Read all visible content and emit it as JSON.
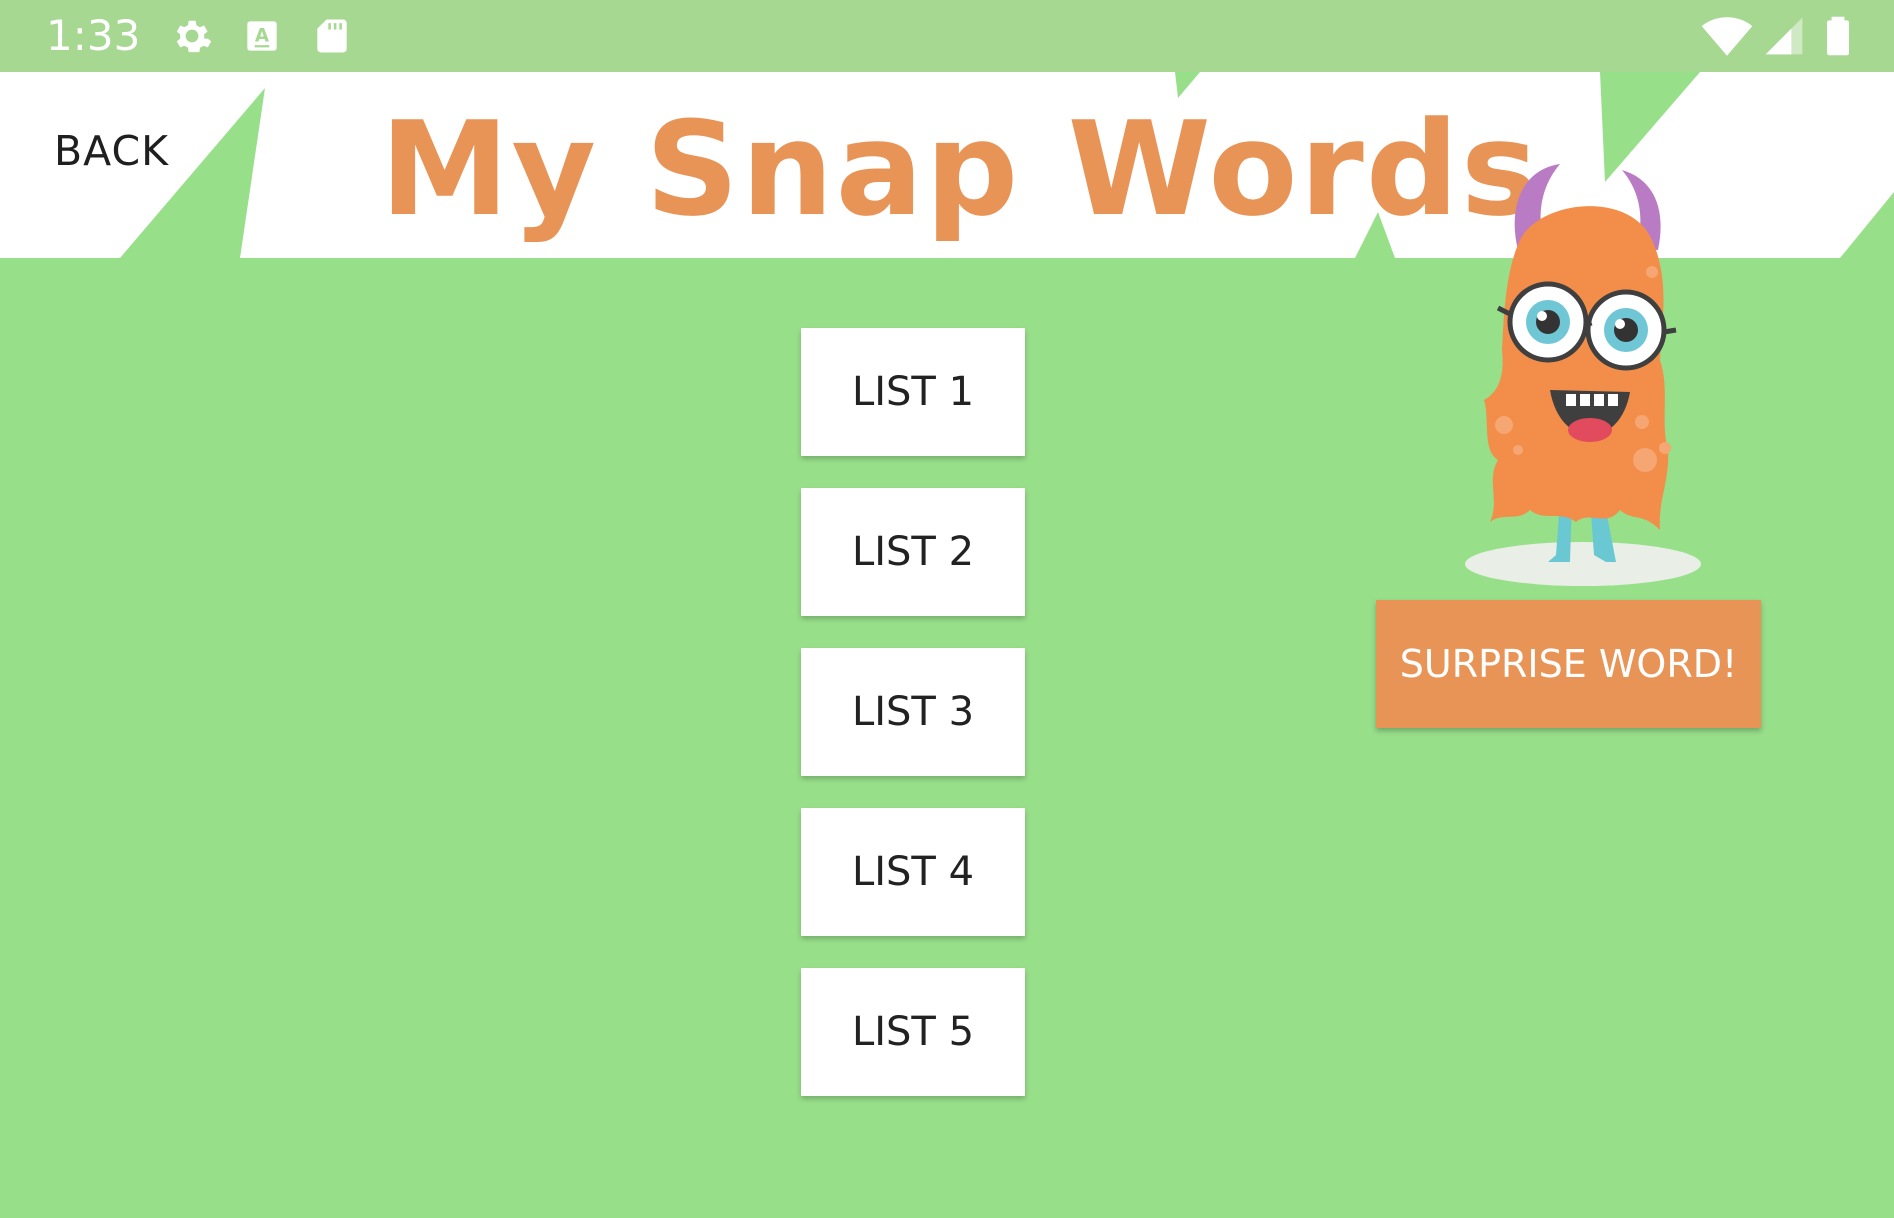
{
  "status_bar": {
    "time": "1:33",
    "icons": [
      "settings-icon",
      "keyboard-a-icon",
      "sd-card-icon",
      "wifi-icon",
      "signal-icon",
      "battery-icon"
    ]
  },
  "header": {
    "back_label": "BACK",
    "title": "My Snap Words"
  },
  "lists": [
    {
      "label": "LIST 1"
    },
    {
      "label": "LIST 2"
    },
    {
      "label": "LIST 3"
    },
    {
      "label": "LIST 4"
    },
    {
      "label": "LIST 5"
    }
  ],
  "mascot": {
    "icon": "orange-monster-mascot-icon"
  },
  "surprise": {
    "label": "SURPRISE WORD!"
  },
  "colors": {
    "background": "#98df8a",
    "status_bar": "#a7d892",
    "accent_orange": "#e99457",
    "header_white": "#ffffff"
  }
}
